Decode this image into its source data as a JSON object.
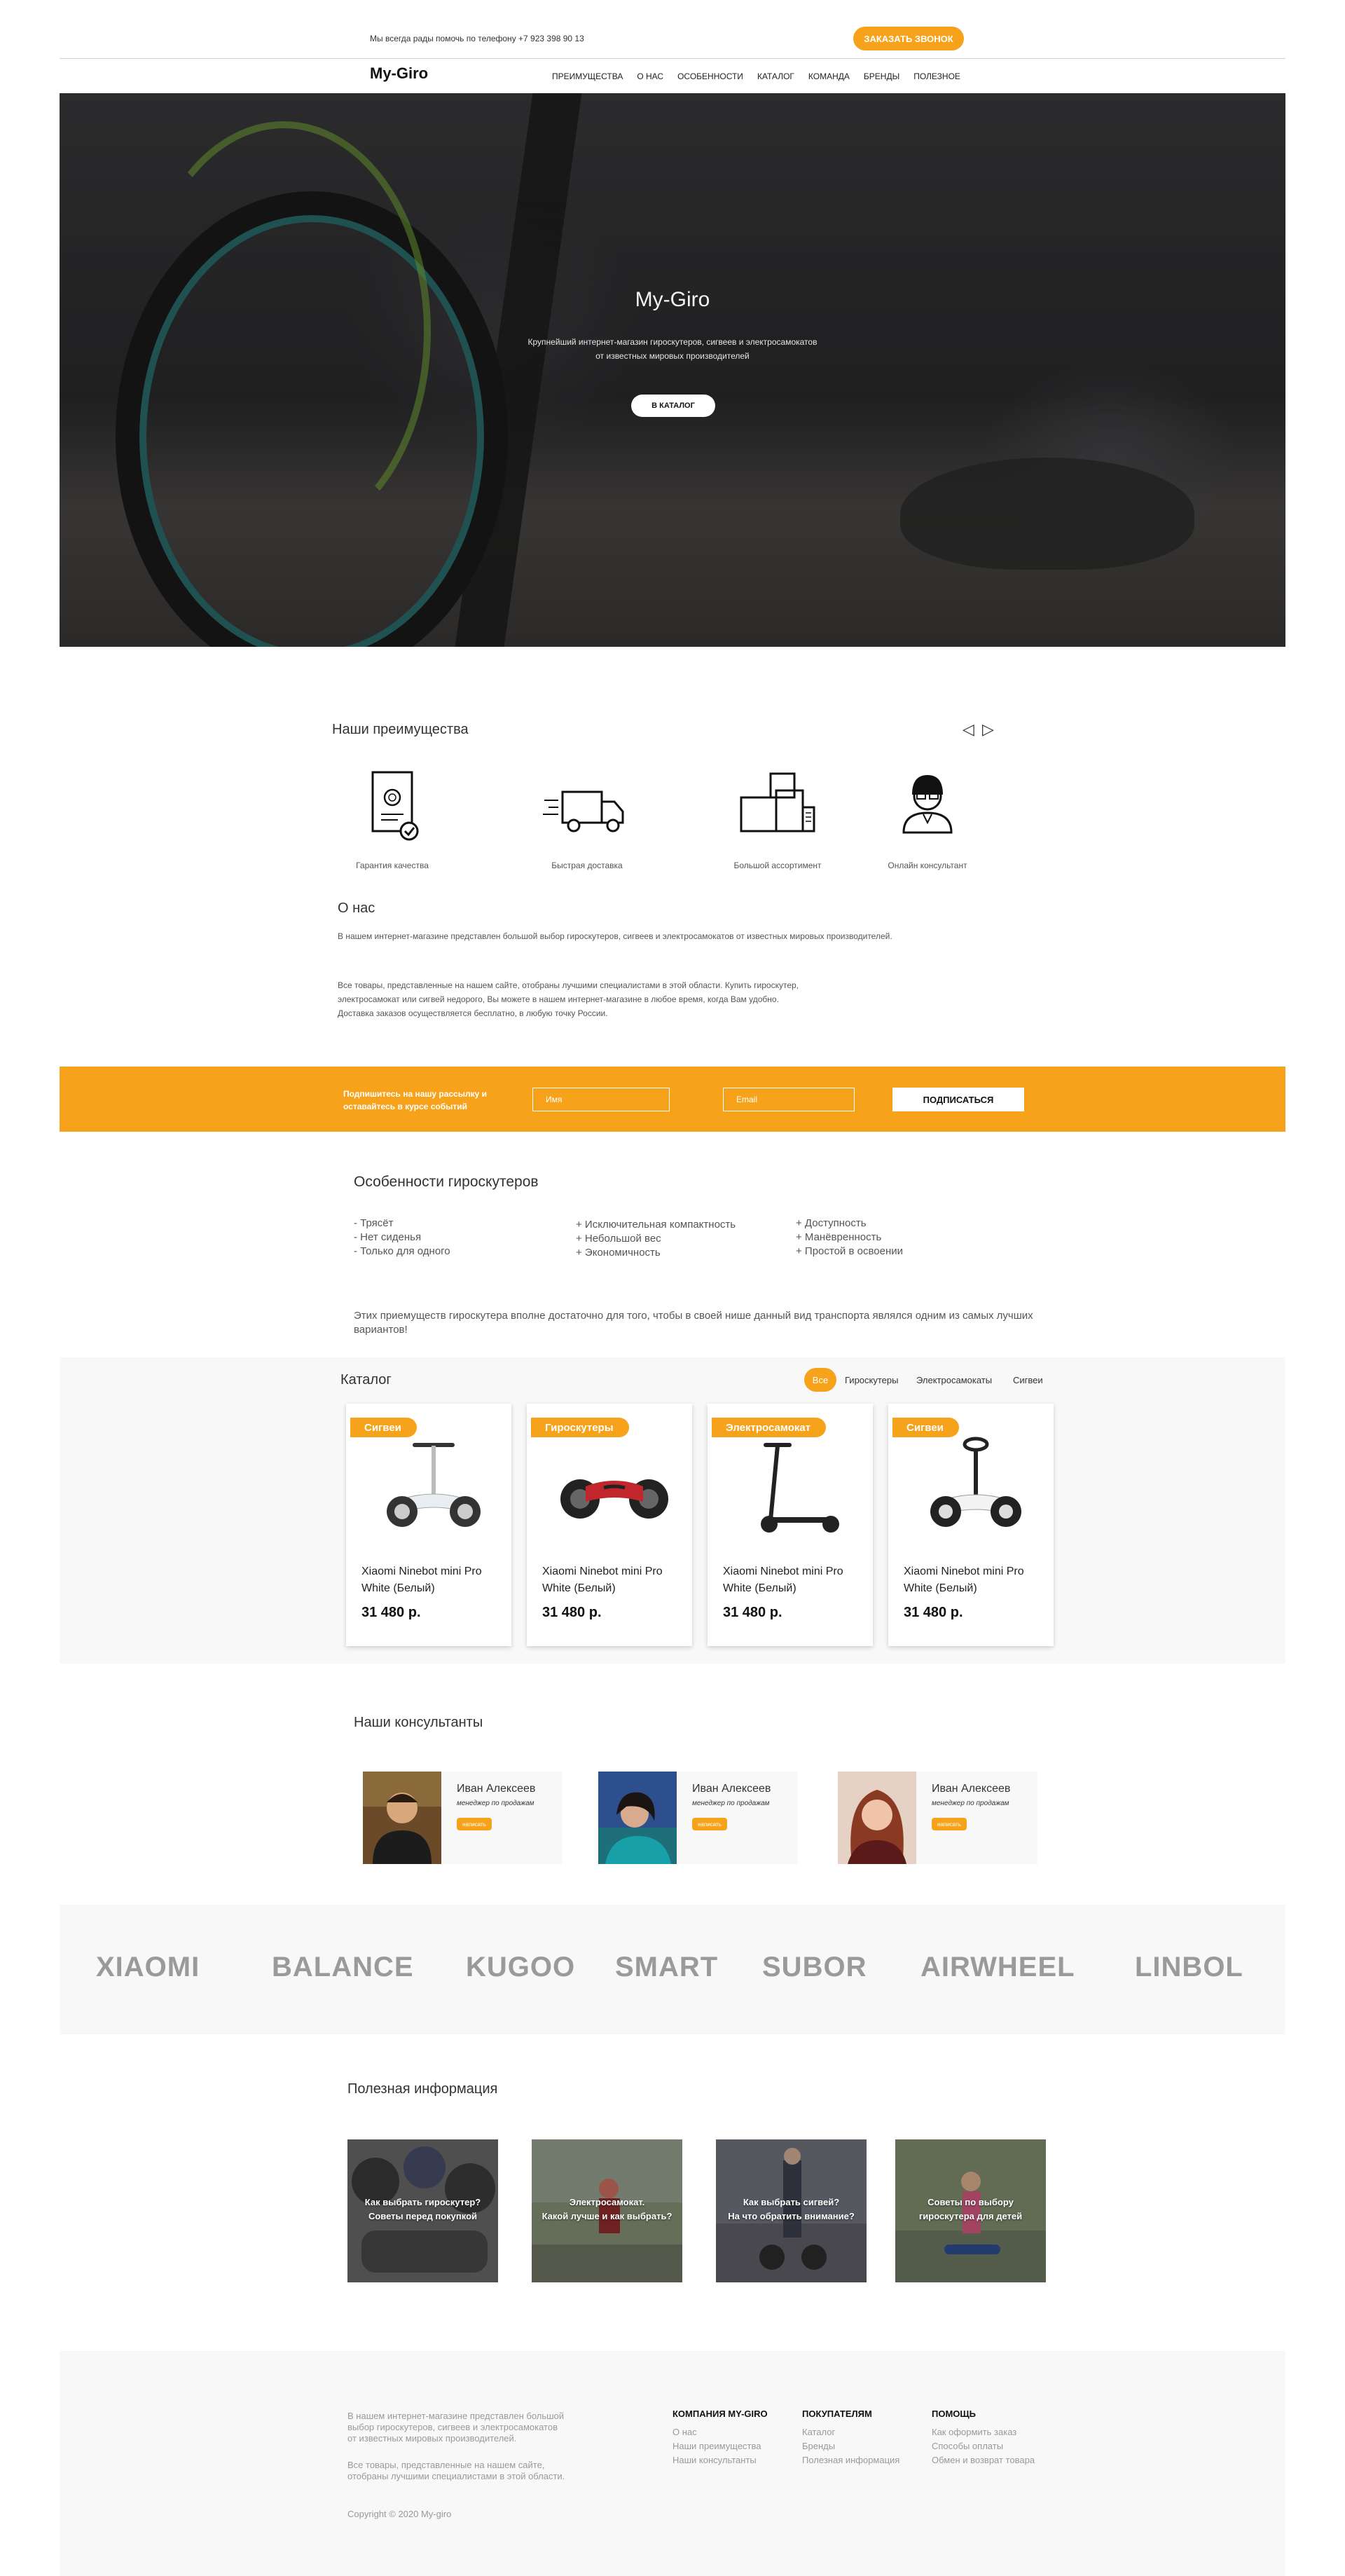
{
  "topbar": {
    "phone_text": "Мы всегда рады помочь по телефону +7 923 398 90 13",
    "callback_label": "ЗАКАЗАТЬ ЗВОНОК"
  },
  "header": {
    "logo": "My-Giro",
    "nav": [
      "Преимущества",
      "О нас",
      "Особенности",
      "Каталог",
      "Команда",
      "Бренды",
      "Полезное"
    ]
  },
  "hero": {
    "title": "My-Giro",
    "subtitle_line1": "Крупнейший интернет-магазин гироскутеров, сигвеев и электросамокатов",
    "subtitle_line2": "от известных мировых производителей",
    "button_label": "В КАТАЛОГ"
  },
  "advantages": {
    "title": "Наши преимущества",
    "prev_arrow": "◁",
    "next_arrow": "▷",
    "items": [
      {
        "label": "Гарантия качества",
        "icon": "certificate-icon"
      },
      {
        "label": "Быстрая доставка",
        "icon": "delivery-truck-icon"
      },
      {
        "label": "Большой ассортимент",
        "icon": "boxes-icon"
      },
      {
        "label": "Онлайн консультант",
        "icon": "consultant-icon"
      }
    ]
  },
  "about": {
    "title": "О нас",
    "p1": "В нашем интернет-магазине представлен большой выбор гироскутеров, сигвеев и электросамокатов от известных мировых производителей.",
    "p2_line1": "Все товары, представленные на нашем сайте, отобраны лучшими специалистами в этой области. Купить гироскутер,",
    "p2_line2": "электросамокат или сигвей недорого, Вы можете в нашем интернет-магазине в любое время, когда Вам удобно.",
    "p2_line3": "Доставка заказов осуществляется бесплатно, в любую точку России."
  },
  "subscribe": {
    "text": "Подпишитесь на нашу рассылку и оставайтесь в курсе событий",
    "name_placeholder": "Имя",
    "email_placeholder": "Email",
    "button_label": "ПОДПИСАТЬСЯ"
  },
  "features": {
    "title": "Особенности гироскутеров",
    "col1": [
      "- Трясёт",
      "- Нет сиденья",
      "- Только для одного"
    ],
    "col2": [
      "+ Исключительная компактность",
      "+ Небольшой вес",
      "+ Экономичность"
    ],
    "col3": [
      "+ Доступность",
      "+ Манёвренность",
      "+ Простой в освоении"
    ],
    "summary": "Этих приемуществ гироскутера вполне достаточно для того, чтобы в своей нише  данный вид транспорта являлся  одним из самых лучших вариантов!"
  },
  "catalog": {
    "title": "Каталог",
    "filters": [
      "Все",
      "Гироскутеры",
      "Электросамокаты",
      "Сигвеи"
    ],
    "active_filter": "Все",
    "products": [
      {
        "badge": "Сигвеи",
        "name": "Xiaomi Ninebot mini Pro White (Белый)",
        "price": "31 480 р."
      },
      {
        "badge": "Гироскутеры",
        "name": "Xiaomi Ninebot mini Pro White (Белый)",
        "price": "31 480 р."
      },
      {
        "badge": "Электросамокат",
        "name": "Xiaomi Ninebot mini Pro White (Белый)",
        "price": "31 480 р."
      },
      {
        "badge": "Сигвеи",
        "name": "Xiaomi Ninebot mini Pro White (Белый)",
        "price": "31 480 р."
      }
    ]
  },
  "consultants": {
    "title": "Наши консультанты",
    "people": [
      {
        "name": "Иван Алексеев",
        "role": "менеджер по продажам",
        "button": "написать"
      },
      {
        "name": "Иван Алексеев",
        "role": "менеджер по продажам",
        "button": "написать"
      },
      {
        "name": "Иван Алексеев",
        "role": "менеджер по продажам",
        "button": "написать"
      }
    ]
  },
  "brands": [
    "XIAOMI",
    "BALANCE",
    "KUGOO",
    "SMART",
    "SUBOR",
    "AIRWHEEL",
    "LINBOL"
  ],
  "useful": {
    "title": "Полезная информация",
    "articles": [
      {
        "line1": "Как выбрать гироскутер?",
        "line2": "Советы перед покупкой"
      },
      {
        "line1": "Электросамокат.",
        "line2": "Какой лучше и как выбрать?"
      },
      {
        "line1": "Как выбрать сигвей?",
        "line2": "На что обратить внимание?"
      },
      {
        "line1": "Советы по выбору",
        "line2": "гироскутера для детей"
      }
    ]
  },
  "footer": {
    "p1_line1": "В нашем интернет-магазине представлен большой",
    "p1_line2": "выбор гироскутеров, сигвеев и электросамокатов",
    "p1_line3": "от известных мировых производителей.",
    "p2_line1": "Все товары, представленные на нашем сайте,",
    "p2_line2": "отобраны лучшими специалистами в этой области.",
    "columns": [
      {
        "title": "Компания My-Giro",
        "links": [
          "О нас",
          "Наши преимущества",
          "Наши консультанты"
        ]
      },
      {
        "title": "Покупателям",
        "links": [
          "Каталог",
          "Бренды",
          "Полезная информация"
        ]
      },
      {
        "title": "Помощь",
        "links": [
          "Как оформить заказ",
          "Способы оплаты",
          "Обмен и возврат товара"
        ]
      }
    ],
    "copyright": "Copyright © 2020 My-giro"
  },
  "colors": {
    "accent": "#f7a21b",
    "band_bg": "#f8f8f8",
    "brand_text": "#9a9a9a"
  }
}
